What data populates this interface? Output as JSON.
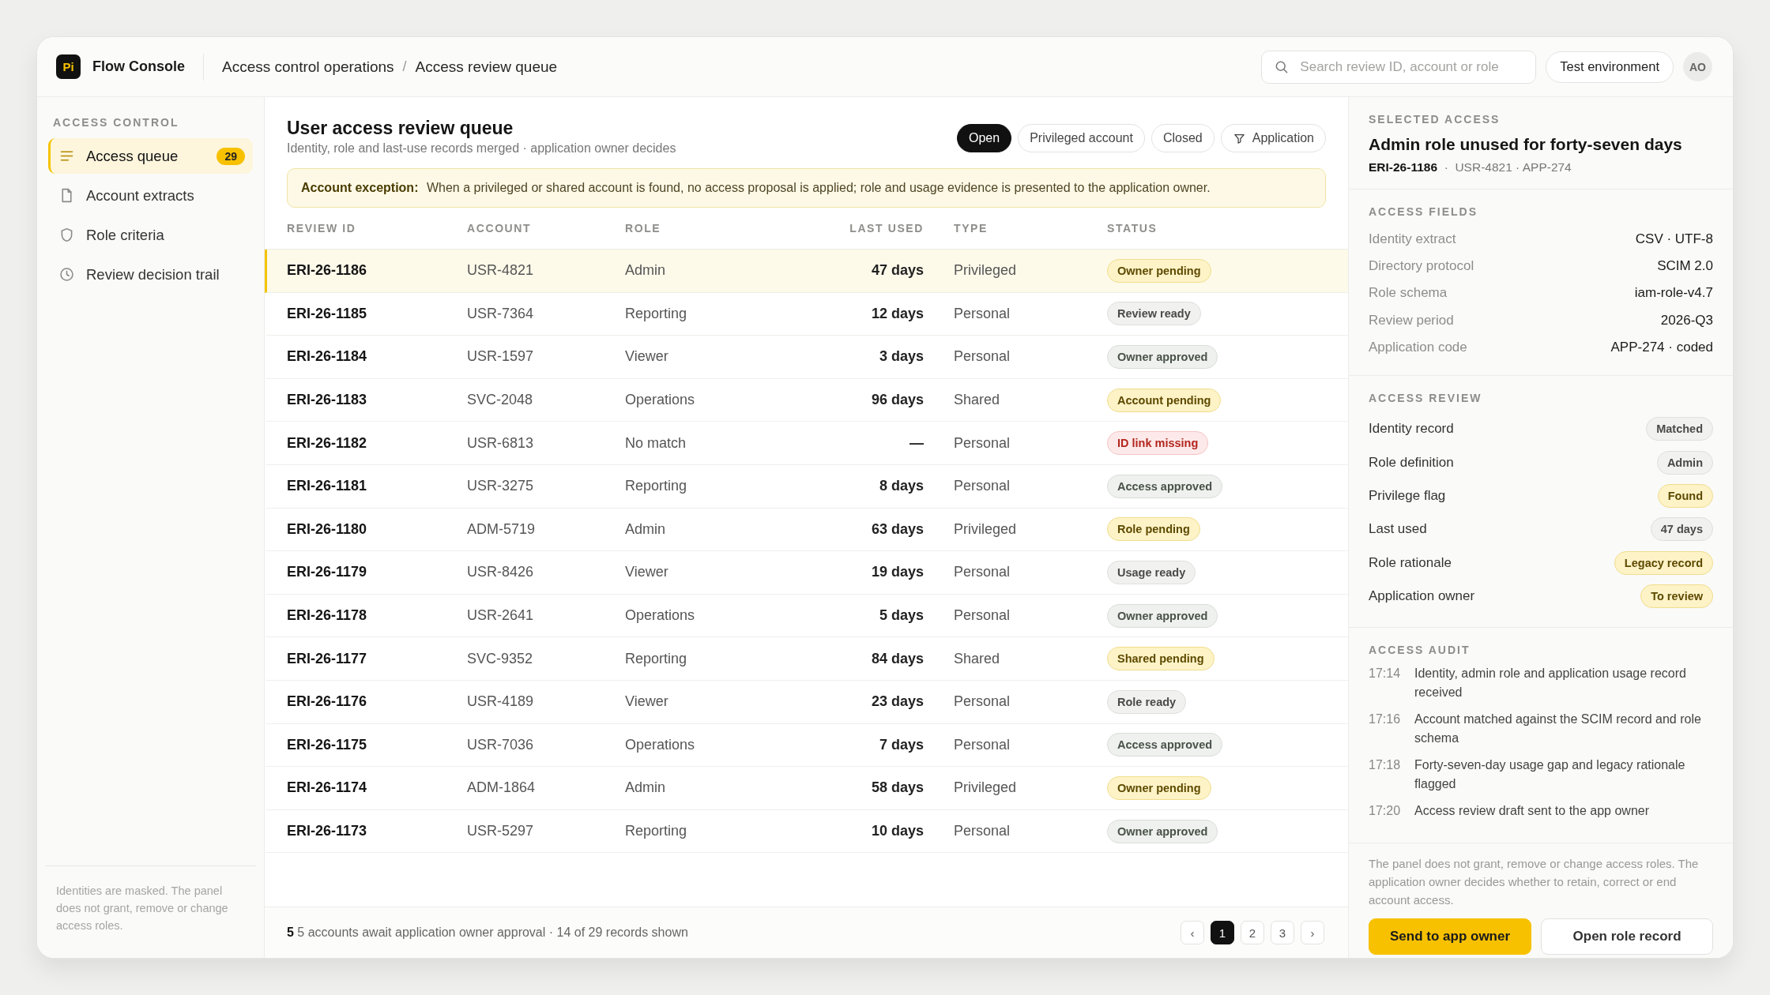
{
  "header": {
    "logo_text": "Pi",
    "app_name": "Flow Console",
    "breadcrumbs": [
      "Access control operations",
      "Access review queue"
    ],
    "breadcrumb_separator": "/",
    "search": {
      "placeholder": "Search review ID, account or role"
    },
    "environment": "Test environment",
    "avatar": "AO"
  },
  "sidebar": {
    "section": "ACCESS CONTROL",
    "items": [
      {
        "label": "Access queue",
        "count": "29",
        "selected": true
      },
      {
        "label": "Account extracts",
        "selected": false
      },
      {
        "label": "Role criteria",
        "selected": false
      },
      {
        "label": "Review decision trail",
        "selected": false
      }
    ],
    "note": "Identities are masked. The panel does not grant, remove or change access roles."
  },
  "queue": {
    "title": "User access review queue",
    "subtitle": "Identity, role and last-use records merged · application owner decides",
    "filters": [
      {
        "label": "Open",
        "kind": "toggle",
        "selected": true
      },
      {
        "label": "Privileged account",
        "kind": "toggle",
        "selected": false
      },
      {
        "label": "Closed",
        "kind": "toggle",
        "selected": false
      },
      {
        "label": "Application",
        "kind": "filter",
        "selected": false
      }
    ],
    "notice": "**Account exception:** When a privileged or shared account is found, no access proposal is applied; role and usage evidence is presented to the application owner.",
    "columns": [
      "REVIEW ID",
      "ACCOUNT",
      "ROLE",
      "LAST USED",
      "TYPE",
      "STATUS"
    ],
    "rows": [
      {
        "id": "ERI-26-1186",
        "account": "USR-4821",
        "role": "Admin",
        "last_used": "47 days",
        "type": "Privileged",
        "status": "Owner pending",
        "kind": "warning",
        "selected": true
      },
      {
        "id": "ERI-26-1185",
        "account": "USR-7364",
        "role": "Reporting",
        "last_used": "12 days",
        "type": "Personal",
        "status": "Review ready",
        "kind": "neutral",
        "selected": false
      },
      {
        "id": "ERI-26-1184",
        "account": "USR-1597",
        "role": "Viewer",
        "last_used": "3 days",
        "type": "Personal",
        "status": "Owner approved",
        "kind": "success",
        "selected": false
      },
      {
        "id": "ERI-26-1183",
        "account": "SVC-2048",
        "role": "Operations",
        "last_used": "96 days",
        "type": "Shared",
        "status": "Account pending",
        "kind": "warning",
        "selected": false
      },
      {
        "id": "ERI-26-1182",
        "account": "USR-6813",
        "role": "No match",
        "last_used": "—",
        "type": "Personal",
        "status": "ID link missing",
        "kind": "danger",
        "selected": false
      },
      {
        "id": "ERI-26-1181",
        "account": "USR-3275",
        "role": "Reporting",
        "last_used": "8 days",
        "type": "Personal",
        "status": "Access approved",
        "kind": "success",
        "selected": false
      },
      {
        "id": "ERI-26-1180",
        "account": "ADM-5719",
        "role": "Admin",
        "last_used": "63 days",
        "type": "Privileged",
        "status": "Role pending",
        "kind": "warning",
        "selected": false
      },
      {
        "id": "ERI-26-1179",
        "account": "USR-8426",
        "role": "Viewer",
        "last_used": "19 days",
        "type": "Personal",
        "status": "Usage ready",
        "kind": "neutral",
        "selected": false
      },
      {
        "id": "ERI-26-1178",
        "account": "USR-2641",
        "role": "Operations",
        "last_used": "5 days",
        "type": "Personal",
        "status": "Owner approved",
        "kind": "success",
        "selected": false
      },
      {
        "id": "ERI-26-1177",
        "account": "SVC-9352",
        "role": "Reporting",
        "last_used": "84 days",
        "type": "Shared",
        "status": "Shared pending",
        "kind": "warning",
        "selected": false
      },
      {
        "id": "ERI-26-1176",
        "account": "USR-4189",
        "role": "Viewer",
        "last_used": "23 days",
        "type": "Personal",
        "status": "Role ready",
        "kind": "neutral",
        "selected": false
      },
      {
        "id": "ERI-26-1175",
        "account": "USR-7036",
        "role": "Operations",
        "last_used": "7 days",
        "type": "Personal",
        "status": "Access approved",
        "kind": "success",
        "selected": false
      },
      {
        "id": "ERI-26-1174",
        "account": "ADM-1864",
        "role": "Admin",
        "last_used": "58 days",
        "type": "Privileged",
        "status": "Owner pending",
        "kind": "warning",
        "selected": false
      },
      {
        "id": "ERI-26-1173",
        "account": "USR-5297",
        "role": "Reporting",
        "last_used": "10 days",
        "type": "Personal",
        "status": "Owner approved",
        "kind": "success",
        "selected": false
      }
    ],
    "summary": "**5** 5 accounts await application owner approval · 14 of 29 records shown",
    "pagination": {
      "previous": "‹",
      "next": "›",
      "pages": [
        {
          "label": "1",
          "selected": true
        },
        {
          "label": "2",
          "selected": false
        },
        {
          "label": "3",
          "selected": false
        }
      ]
    }
  },
  "detail": {
    "section": "SELECTED ACCESS",
    "title": "Admin role unused for forty-seven days",
    "meta": "**ERI-26-1186**  ·  USR-4821 · APP-274",
    "fields_title": "ACCESS FIELDS",
    "fields": [
      {
        "label": "Identity extract",
        "value": "CSV · UTF-8"
      },
      {
        "label": "Directory protocol",
        "value": "SCIM 2.0"
      },
      {
        "label": "Role schema",
        "value": "iam-role-v4.7"
      },
      {
        "label": "Review period",
        "value": "2026-Q3"
      },
      {
        "label": "Application code",
        "value": "APP-274 · coded"
      }
    ],
    "review_title": "ACCESS REVIEW",
    "review": [
      {
        "label": "Identity record",
        "status": "Matched",
        "kind": "neutral"
      },
      {
        "label": "Role definition",
        "status": "Admin",
        "kind": "neutral"
      },
      {
        "label": "Privilege flag",
        "status": "Found",
        "kind": "warning"
      },
      {
        "label": "Last used",
        "status": "47 days",
        "kind": "neutral"
      },
      {
        "label": "Role rationale",
        "status": "Legacy record",
        "kind": "warning"
      },
      {
        "label": "Application owner",
        "status": "To review",
        "kind": "warning"
      }
    ],
    "audit_title": "ACCESS AUDIT",
    "audit": [
      {
        "time": "17:14",
        "text": "Identity, admin role and application usage record received"
      },
      {
        "time": "17:16",
        "text": "Account matched against the SCIM record and role schema"
      },
      {
        "time": "17:18",
        "text": "Forty-seven-day usage gap and legacy rationale flagged"
      },
      {
        "time": "17:20",
        "text": "Access review draft sent to the app owner"
      }
    ],
    "note": "The panel does not grant, remove or change access roles. The application owner decides whether to retain, correct or end account access.",
    "actions": [
      {
        "label": "Send to app owner",
        "kind": "primary"
      },
      {
        "label": "Open role record",
        "kind": "secondary"
      }
    ]
  }
}
